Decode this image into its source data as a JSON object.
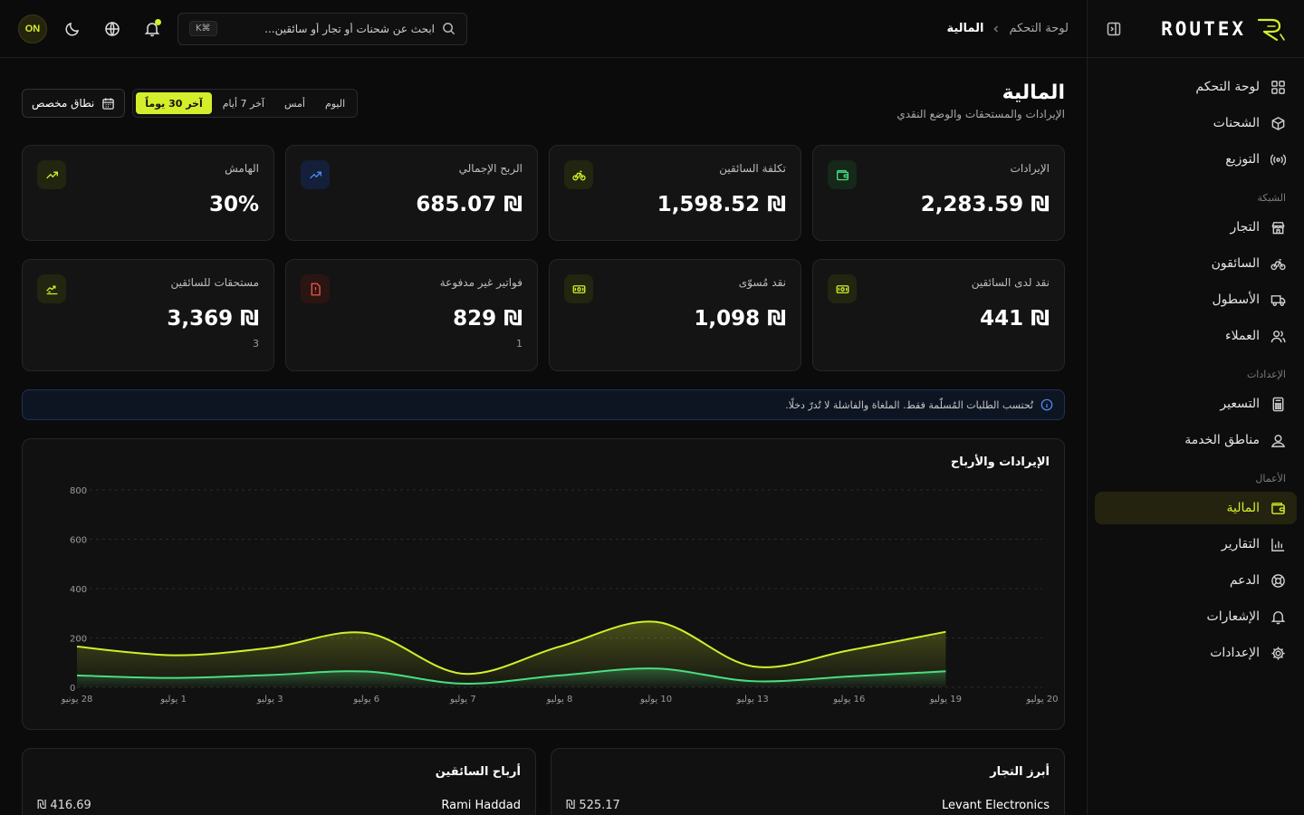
{
  "brand": {
    "name": "ROUTEX"
  },
  "topbar": {
    "breadcrumb_root": "لوحة التحكم",
    "breadcrumb_current": "المالية",
    "search_placeholder": "ابحث عن شحنات أو تجار أو سائقين...",
    "search_shortcut": "K⌘",
    "avatar_text": "ON"
  },
  "sidebar": {
    "items": [
      {
        "label": "لوحة التحكم",
        "icon": "grid-icon"
      },
      {
        "label": "الشحنات",
        "icon": "box-icon"
      },
      {
        "label": "التوزيع",
        "icon": "broadcast-icon"
      }
    ],
    "network_label": "الشبكة",
    "network_items": [
      {
        "label": "التجار",
        "icon": "store-icon"
      },
      {
        "label": "السائقون",
        "icon": "bike-icon"
      },
      {
        "label": "الأسطول",
        "icon": "truck-icon"
      },
      {
        "label": "العملاء",
        "icon": "users-icon"
      }
    ],
    "settings_label": "الإعدادات",
    "settings_items": [
      {
        "label": "التسعير",
        "icon": "calculator-icon"
      },
      {
        "label": "مناطق الخدمة",
        "icon": "map-pin-icon"
      }
    ],
    "business_label": "الأعمال",
    "business_items": [
      {
        "label": "المالية",
        "icon": "wallet-icon",
        "active": true
      },
      {
        "label": "التقارير",
        "icon": "bar-chart-icon"
      },
      {
        "label": "الدعم",
        "icon": "lifebuoy-icon"
      },
      {
        "label": "الإشعارات",
        "icon": "bell-icon"
      },
      {
        "label": "الإعدادات",
        "icon": "gear-icon"
      }
    ]
  },
  "page": {
    "title": "المالية",
    "subtitle": "الإيرادات والمستحقات والوضع النقدي",
    "ranges": [
      "اليوم",
      "أمس",
      "آخر 7 أيام",
      "آخر 30 يوماً"
    ],
    "active_range": "آخر 30 يوماً",
    "custom_range": "نطاق مخصص"
  },
  "stats": [
    {
      "label": "الإيرادات",
      "value": "₪ 2,283.59",
      "icon": "wallet-icon",
      "tone": "green"
    },
    {
      "label": "تكلفة السائقين",
      "value": "₪ 1,598.52",
      "icon": "bike-icon",
      "tone": "lime"
    },
    {
      "label": "الربح الإجمالي",
      "value": "₪ 685.07",
      "icon": "trend-up-icon",
      "tone": "blue"
    },
    {
      "label": "الهامش",
      "value": "30%",
      "icon": "trend-up-icon",
      "tone": "lime"
    },
    {
      "label": "نقد لدى السائقين",
      "value": "₪ 441",
      "sub": "",
      "icon": "cash-icon",
      "tone": "lime"
    },
    {
      "label": "نقد مُسوّى",
      "value": "₪ 1,098",
      "sub": "",
      "icon": "cash-icon",
      "tone": "lime"
    },
    {
      "label": "فواتير غير مدفوعة",
      "value": "₪ 829",
      "sub": "1",
      "icon": "invoice-icon",
      "tone": "red"
    },
    {
      "label": "مستحقات للسائقين",
      "value": "₪ 3,369",
      "sub": "3",
      "icon": "payout-icon",
      "tone": "lime"
    }
  ],
  "info_text": "تُحتسب الطلبات المُسلّمة فقط. الملغاة والفاشلة لا تُدرّ دخلًا.",
  "chart_data": {
    "type": "area",
    "title": "الإيرادات والأرباح",
    "categories": [
      "28 يونيو",
      "1 يوليو",
      "3 يوليو",
      "6 يوليو",
      "7 يوليو",
      "8 يوليو",
      "10 يوليو",
      "13 يوليو",
      "16 يوليو",
      "19 يوليو",
      "20 يوليو"
    ],
    "ylim": [
      0,
      800
    ],
    "yticks": [
      0,
      200,
      400,
      600,
      800
    ],
    "grid": true,
    "series": [
      {
        "values": [
          165,
          130,
          160,
          220,
          55,
          165,
          265,
          85,
          150,
          225,
          null
        ],
        "color": "#d4ee2b"
      },
      {
        "values": [
          48,
          38,
          50,
          64,
          15,
          48,
          76,
          25,
          44,
          65,
          null
        ],
        "color": "#4ade80"
      }
    ]
  },
  "bottom": {
    "merchants_title": "أبرز التجار",
    "merchant_name": "Levant Electronics",
    "merchant_value": "₪ 525.17",
    "drivers_title": "أرباح السائقين",
    "driver_name": "Rami Haddad",
    "driver_value": "₪ 416.69"
  }
}
